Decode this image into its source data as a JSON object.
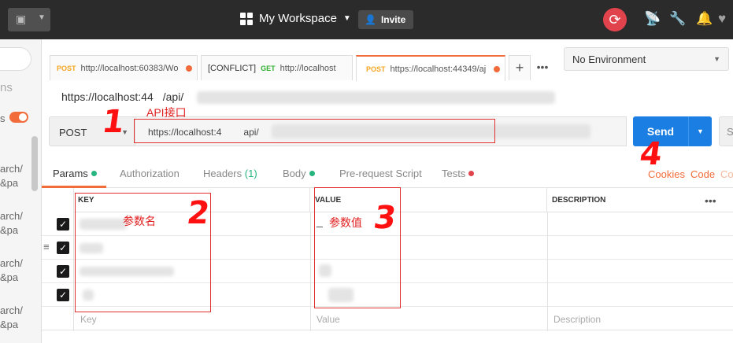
{
  "header": {
    "workspace_name": "My Workspace",
    "invite_label": "Invite"
  },
  "sidebar": {
    "fragments": [
      "ns",
      "s",
      "arch/",
      "&pa",
      "arch/",
      "&pa",
      "arch/",
      "&pa",
      "arch/",
      "&pa"
    ]
  },
  "tabs": [
    {
      "method": "POST",
      "url": "http://localhost:60383/Wo"
    },
    {
      "prefix": "[CONFLICT]",
      "method": "GET",
      "url": "http://localhost"
    },
    {
      "method": "POST",
      "url": "https://localhost:44349/aj"
    }
  ],
  "environment": {
    "selected": "No Environment"
  },
  "request": {
    "name": "https://localhost:44",
    "name_tail": "/api/",
    "method": "POST",
    "url_start": "https://localhost:4",
    "url_mid": "api/"
  },
  "actions": {
    "send_label": "Send",
    "save_label": "S"
  },
  "subtabs": {
    "params": "Params",
    "authorization": "Authorization",
    "headers": "Headers",
    "headers_count": "(1)",
    "body": "Body",
    "prerequest": "Pre-request Script",
    "tests": "Tests",
    "cookies": "Cookies",
    "code": "Code",
    "comments": "Co"
  },
  "params_table": {
    "headers": [
      "KEY",
      "VALUE",
      "DESCRIPTION"
    ],
    "placeholders": {
      "key": "Key",
      "value": "Value",
      "description": "Description"
    }
  },
  "annotations": {
    "api_label": "API接口",
    "key_label": "参数名",
    "value_label": "参数值",
    "value_prefix": "_",
    "n1": "1",
    "n2": "2",
    "n3": "3",
    "n4": "4"
  },
  "colors": {
    "accent": "#f26b3a",
    "send": "#1b7ee2",
    "topbar": "#2b2b2b",
    "annotation": "#e02020"
  }
}
